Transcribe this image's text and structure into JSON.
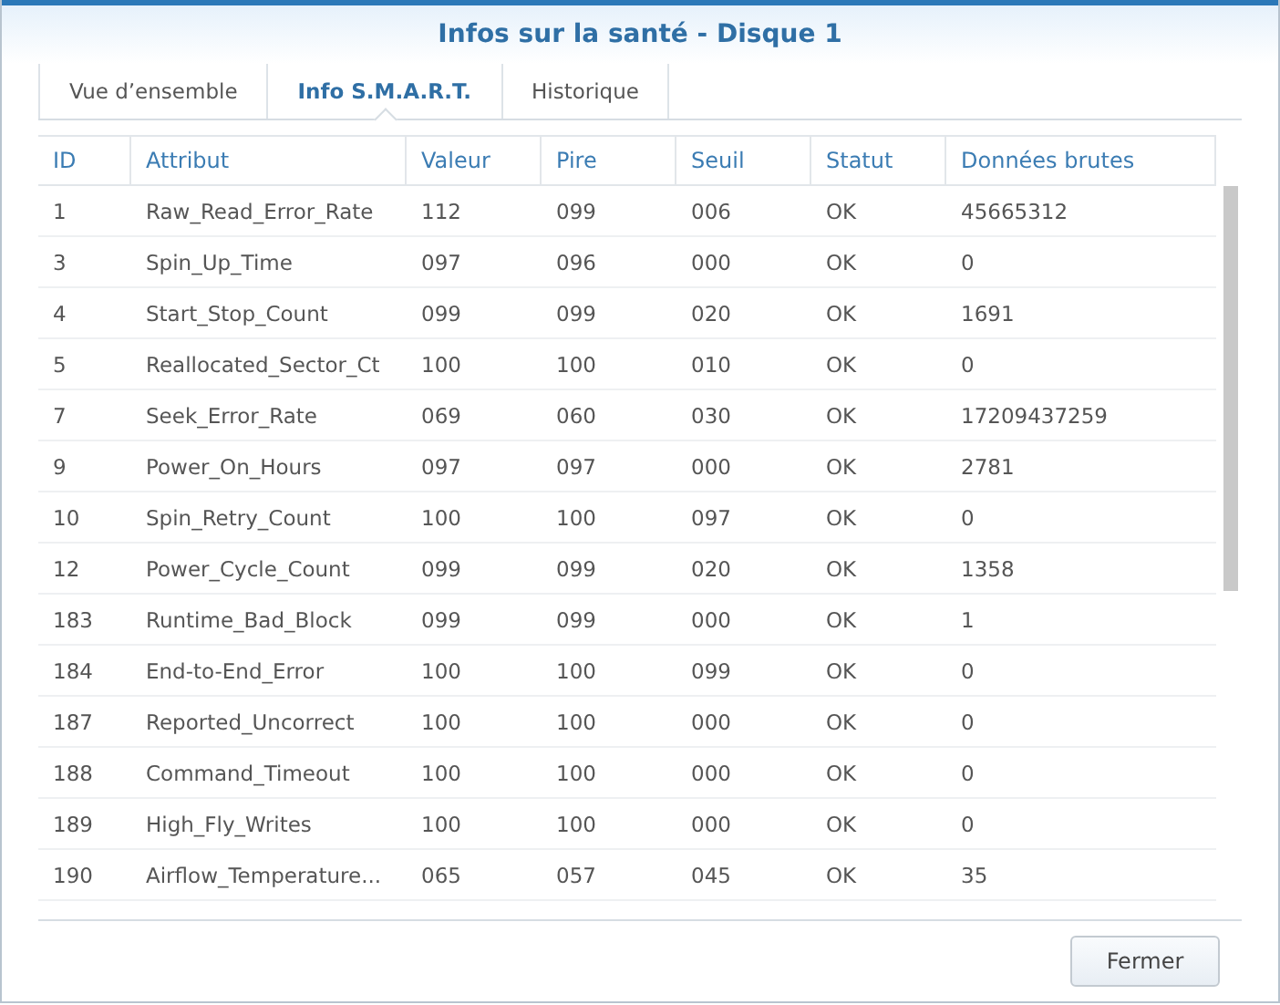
{
  "window": {
    "title": "Infos sur la santé - Disque 1"
  },
  "tabs": [
    {
      "label": "Vue d’ensemble",
      "selected": false
    },
    {
      "label": "Info S.M.A.R.T.",
      "selected": true
    },
    {
      "label": "Historique",
      "selected": false
    }
  ],
  "table": {
    "columns": [
      "ID",
      "Attribut",
      "Valeur",
      "Pire",
      "Seuil",
      "Statut",
      "Données brutes"
    ],
    "rows": [
      [
        "1",
        "Raw_Read_Error_Rate",
        "112",
        "099",
        "006",
        "OK",
        "45665312"
      ],
      [
        "3",
        "Spin_Up_Time",
        "097",
        "096",
        "000",
        "OK",
        "0"
      ],
      [
        "4",
        "Start_Stop_Count",
        "099",
        "099",
        "020",
        "OK",
        "1691"
      ],
      [
        "5",
        "Reallocated_Sector_Ct",
        "100",
        "100",
        "010",
        "OK",
        "0"
      ],
      [
        "7",
        "Seek_Error_Rate",
        "069",
        "060",
        "030",
        "OK",
        "17209437259"
      ],
      [
        "9",
        "Power_On_Hours",
        "097",
        "097",
        "000",
        "OK",
        "2781"
      ],
      [
        "10",
        "Spin_Retry_Count",
        "100",
        "100",
        "097",
        "OK",
        "0"
      ],
      [
        "12",
        "Power_Cycle_Count",
        "099",
        "099",
        "020",
        "OK",
        "1358"
      ],
      [
        "183",
        "Runtime_Bad_Block",
        "099",
        "099",
        "000",
        "OK",
        "1"
      ],
      [
        "184",
        "End-to-End_Error",
        "100",
        "100",
        "099",
        "OK",
        "0"
      ],
      [
        "187",
        "Reported_Uncorrect",
        "100",
        "100",
        "000",
        "OK",
        "0"
      ],
      [
        "188",
        "Command_Timeout",
        "100",
        "100",
        "000",
        "OK",
        "0"
      ],
      [
        "189",
        "High_Fly_Writes",
        "100",
        "100",
        "000",
        "OK",
        "0"
      ],
      [
        "190",
        "Airflow_Temperature...",
        "065",
        "057",
        "045",
        "OK",
        "35"
      ]
    ]
  },
  "buttons": [
    "Fermer"
  ]
}
